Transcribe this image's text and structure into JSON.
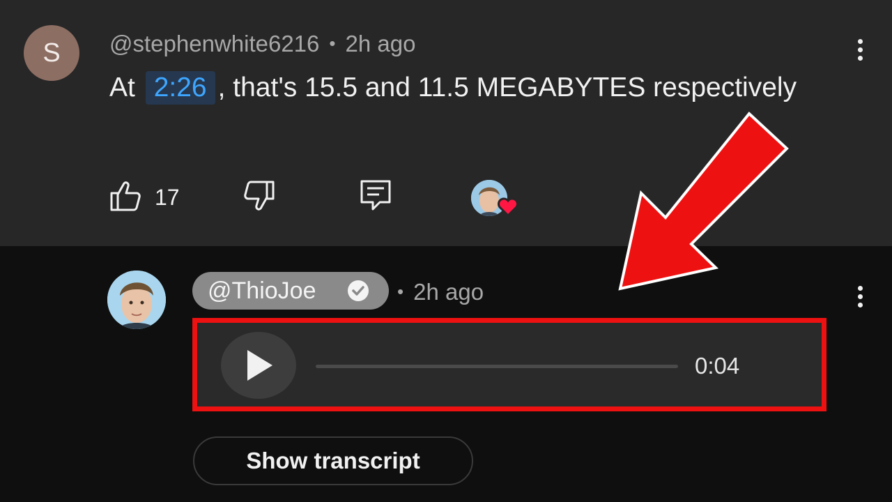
{
  "comment": {
    "avatar_letter": "S",
    "author": "@stephenwhite6216",
    "separator": "•",
    "time": "2h ago",
    "text_before": "At",
    "timestamp_link": "2:26",
    "text_after": ", that's 15.5 and 11.5 MEGABYTES respectively",
    "like_count": "17",
    "icons": [
      "thumb-up-icon",
      "thumb-down-icon",
      "reply-icon",
      "creator-heart-icon",
      "more-vert-icon"
    ]
  },
  "reply": {
    "author": "@ThioJoe",
    "separator": "•",
    "time": "2h ago",
    "verified_icon": "verified-check-icon",
    "audio": {
      "duration": "0:04",
      "progress": 0.0
    },
    "transcript_button": "Show transcript"
  },
  "annotation": {
    "arrow_color": "#ee1111",
    "highlight_color": "#ee1111"
  }
}
